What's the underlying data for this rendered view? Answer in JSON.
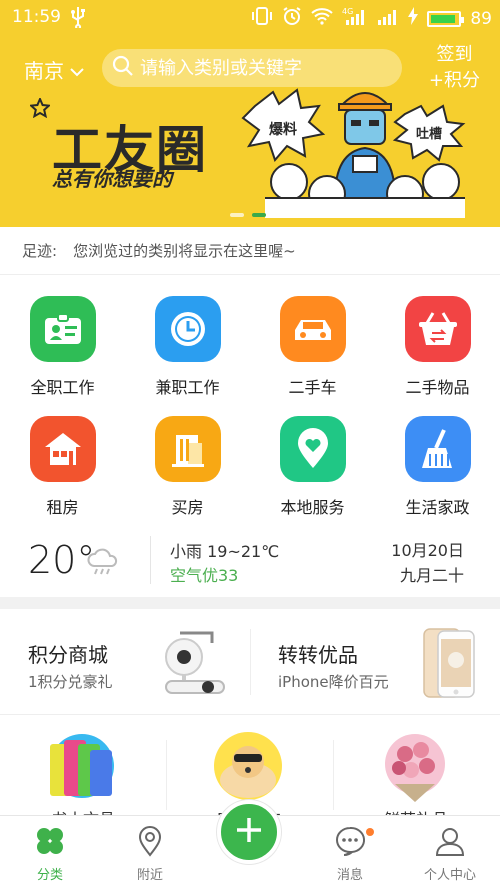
{
  "status_bar": {
    "time": "11:59",
    "battery": "89",
    "network": "4G"
  },
  "header": {
    "city": "南京",
    "search_placeholder": "请输入类别或关键字",
    "signin_line1": "签到",
    "signin_line2": "+积分"
  },
  "banner": {
    "title": "工友圈",
    "subtitle": "总有你想要的",
    "tag_left": "爆料",
    "tag_right": "吐槽",
    "active_slide": 2,
    "slide_count": 2
  },
  "footprint": {
    "label": "足迹:",
    "text": "您浏览过的类别将显示在这里喔~"
  },
  "categories": [
    {
      "label": "全职工作",
      "icon": "id-card-icon",
      "color": "#2fbd56"
    },
    {
      "label": "兼职工作",
      "icon": "clock-icon",
      "color": "#2b9ef0"
    },
    {
      "label": "二手车",
      "icon": "car-icon",
      "color": "#ff8a1f"
    },
    {
      "label": "二手物品",
      "icon": "basket-icon",
      "color": "#f24444"
    },
    {
      "label": "租房",
      "icon": "house-icon",
      "color": "#f2542e"
    },
    {
      "label": "买房",
      "icon": "building-icon",
      "color": "#f8a814"
    },
    {
      "label": "本地服务",
      "icon": "location-heart-icon",
      "color": "#20c785"
    },
    {
      "label": "生活家政",
      "icon": "broom-icon",
      "color": "#3d8ef5"
    }
  ],
  "weather": {
    "temperature": "20°",
    "description": "小雨 19~21℃",
    "air_quality": "空气优33",
    "date": "10月20日",
    "lunar_date": "九月二十",
    "icon": "cloud-rain-icon"
  },
  "promos": [
    {
      "title": "积分商城",
      "subtitle": "1积分兑豪礼",
      "image": "robot-camera-image"
    },
    {
      "title": "转转优品",
      "subtitle": "iPhone降价百元",
      "image": "iphone-image"
    }
  ],
  "cards": [
    {
      "label": "书本文具",
      "image": "folders-image"
    },
    {
      "label": "宠物狗狗",
      "image": "dog-image"
    },
    {
      "label": "鲜花礼品",
      "image": "flowers-image"
    }
  ],
  "nav": {
    "items": [
      {
        "label": "分类",
        "icon": "clover-icon",
        "active": true
      },
      {
        "label": "附近",
        "icon": "map-pin-icon",
        "active": false
      },
      {
        "label": "消息",
        "icon": "chat-icon",
        "active": false,
        "badge": true
      },
      {
        "label": "个人中心",
        "icon": "user-icon",
        "active": false
      }
    ],
    "publish_icon": "plus-icon"
  },
  "colors": {
    "brand_yellow": "#f6cf2e",
    "brand_green": "#3cb64d"
  }
}
